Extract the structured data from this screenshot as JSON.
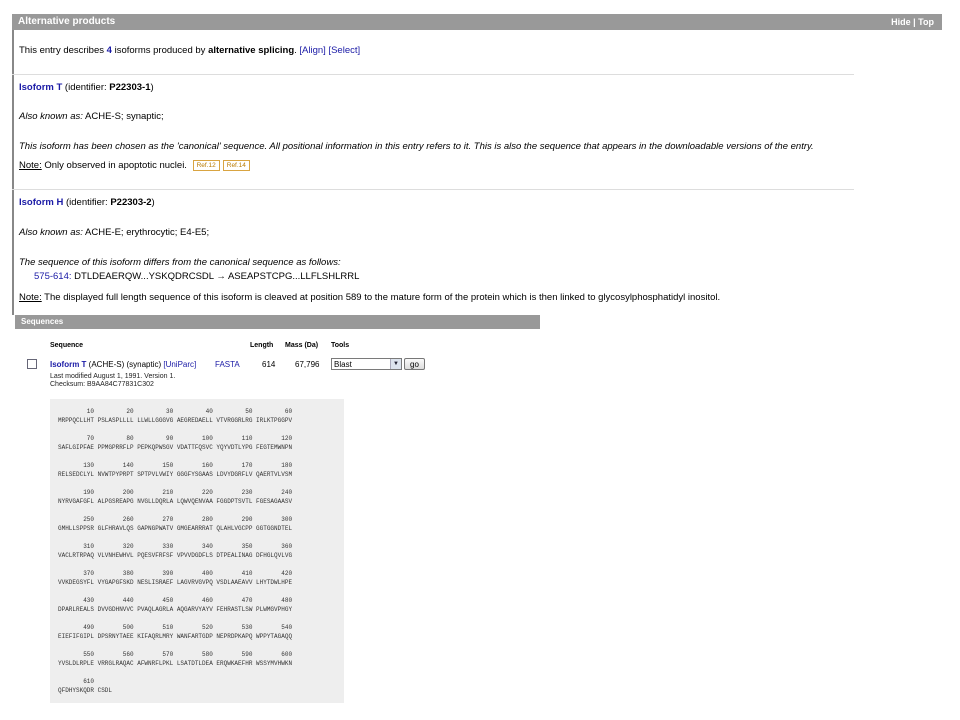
{
  "alt_products": {
    "header": "Alternative products",
    "hide": "Hide",
    "sep": "|",
    "top": "Top",
    "intro": {
      "pre": "This entry describes ",
      "count": "4",
      "mid": " isoforms produced by ",
      "mechanism": "alternative splicing",
      "post": ".",
      "align": "[Align]",
      "select": "[Select]"
    },
    "isoform_t": {
      "name": "Isoform T",
      "identifier_label": " (identifier: ",
      "identifier": "P22303-1",
      "close": ")",
      "aka_label": "Also known as:",
      "aka": " ACHE-S; synaptic;",
      "canonical_text": "This isoform has been chosen as the 'canonical' sequence. All positional information in this entry refers to it. This is also the sequence that appears in the downloadable versions of the entry.",
      "note_label": "Note:",
      "note": " Only observed in apoptotic nuclei.",
      "refs": [
        "Ref.12",
        "Ref.14"
      ]
    },
    "isoform_h": {
      "name": "Isoform H",
      "identifier_label": " (identifier: ",
      "identifier": "P22303-2",
      "close": ")",
      "aka_label": "Also known as:",
      "aka": " ACHE-E; erythrocytic; E4-E5;",
      "differs_text": "The sequence of this isoform differs from the canonical sequence as follows:",
      "variant_range": "575-614:",
      "variant_text": " DTLDEAERQW...YSKQDRCSDL → ASEAPSTCPG...LLFLSHLRRL",
      "note_label": "Note:",
      "note": " The displayed full length sequence of this isoform is cleaved at position 589 to the mature form of the protein which is then linked to glycosylphosphatidyl inositol."
    }
  },
  "sequences": {
    "header": "Sequences",
    "columns": [
      "Sequence",
      "Length",
      "Mass (Da)",
      "Tools"
    ],
    "row": {
      "isoform": "Isoform T",
      "desc": " (ACHE-S) (synaptic) ",
      "uniparc": "[UniParc]",
      "fasta": "FASTA",
      "length": "614",
      "mass": "67,796",
      "tool": "Blast",
      "go": "go",
      "modified": "Last modified August 1, 1991. Version 1.",
      "checksum": "Checksum: B9AA84C77831C302"
    },
    "seq_blocks": [
      {
        "nums": "        10         20         30         40         50         60",
        "seq": "MRPPQCLLHT PSLASPLLLL LLWLLGGGVG AEGREDAELL VTVRGGRLRG IRLKTPGGPV"
      },
      {
        "nums": "        70         80         90        100        110        120",
        "seq": "SAFLGIPFAE PPMGPRRFLP PEPKQPWSGV VDATTFQSVC YQYVDTLYPG FEGTEMWNPN"
      },
      {
        "nums": "       130        140        150        160        170        180",
        "seq": "RELSEDCLYL NVWTPYPRPT SPTPVLVWIY GGGFYSGAAS LDVYDGRFLV QAERTVLVSM"
      },
      {
        "nums": "       190        200        210        220        230        240",
        "seq": "NYRVGAFGFL ALPGSREAPG NVGLLDQRLA LQWVQENVAA FGGDPTSVTL FGESAGAASV"
      },
      {
        "nums": "       250        260        270        280        290        300",
        "seq": "GMHLLSPPSR GLFHRAVLQS GAPNGPWATV GMGEARRRAT QLAHLVGCPP GGTGGNDTEL"
      },
      {
        "nums": "       310        320        330        340        350        360",
        "seq": "VACLRTRPAQ VLVNHEWHVL PQESVFRFSF VPVVDGDFLS DTPEALINAG DFHGLQVLVG"
      },
      {
        "nums": "       370        380        390        400        410        420",
        "seq": "VVKDEGSYFL VYGAPGFSKD NESLISRAEF LAGVRVGVPQ VSDLAAEAVV LHYTDWLHPE"
      },
      {
        "nums": "       430        440        450        460        470        480",
        "seq": "DPARLREALS DVVGDHNVVC PVAQLAGRLA AQGARVYAYV FEHRASTLSW PLWMGVPHGY"
      },
      {
        "nums": "       490        500        510        520        530        540",
        "seq": "EIEFIFGIPL DPSRNYTAEE KIFAQRLMRY WANFARTGDP NEPRDPKAPQ WPPYTAGAQQ"
      },
      {
        "nums": "       550        560        570        580        590        600",
        "seq": "YVSLDLRPLE VRRGLRAQAC AFWNRFLPKL LSATDTLDEA ERQWKAEFHR WSSYMVHWKN"
      },
      {
        "nums": "       610",
        "seq": "QFDHYSKQDR CSDL"
      }
    ]
  }
}
